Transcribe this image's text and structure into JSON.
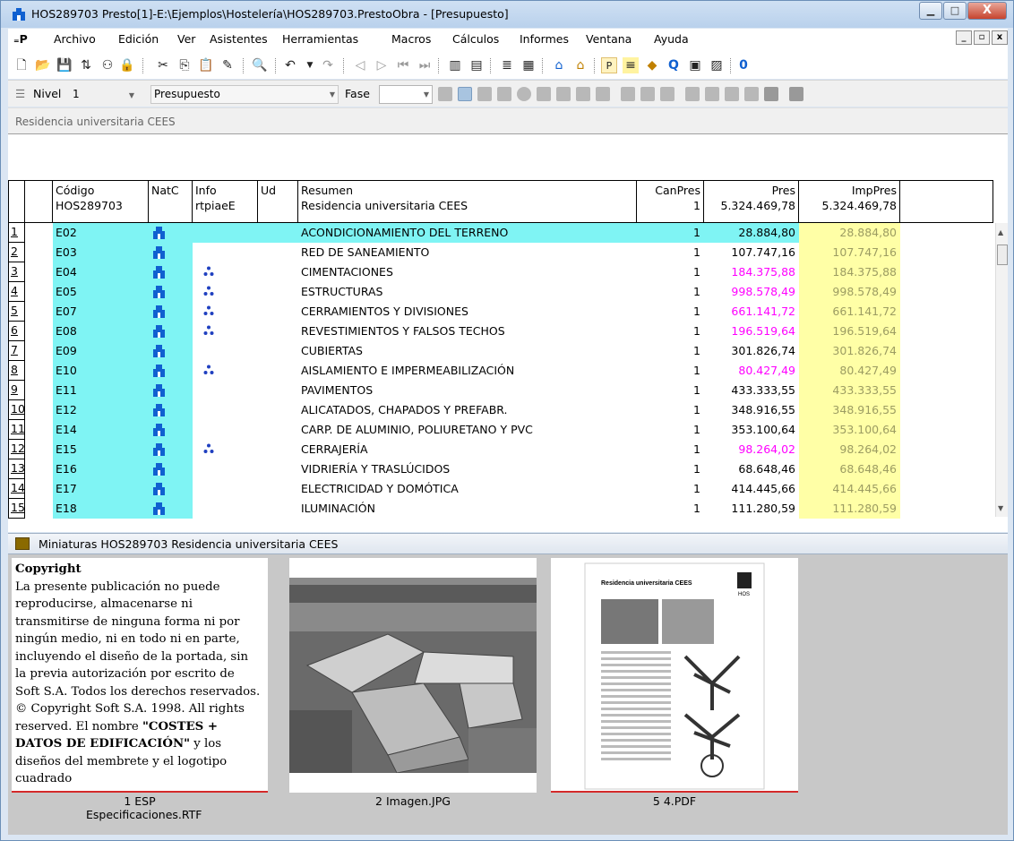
{
  "window": {
    "title": "HOS289703 Presto[1]-E:\\Ejemplos\\Hostelería\\HOS289703.PrestoObra - [Presupuesto]",
    "minimize": "▁",
    "maximize": "□",
    "close": "X"
  },
  "menu": {
    "items": [
      "Archivo",
      "Edición",
      "Ver",
      "Asistentes",
      "Herramientas",
      "Macros",
      "Cálculos",
      "Informes",
      "Ventana",
      "Ayuda"
    ],
    "mdi": [
      "_",
      "▫",
      "x"
    ]
  },
  "toolbar2": {
    "nivel_label": "Nivel",
    "nivel_value": "1",
    "view_value": "Presupuesto",
    "fase_label": "Fase",
    "fase_value": ""
  },
  "breadcrumb": "Residencia universitaria CEES",
  "table": {
    "headers": {
      "codigo": "Código",
      "codigo_sub": "HOS289703",
      "natc": "NatC",
      "info": "Info",
      "info_sub": "rtpiaeE",
      "ud": "Ud",
      "resumen": "Resumen",
      "resumen_sub": "Residencia universitaria CEES",
      "canpres": "CanPres",
      "canpres_sub": "1",
      "pres": "Pres",
      "pres_sub": "5.324.469,78",
      "imppres": "ImpPres",
      "imppres_sub": "5.324.469,78"
    },
    "rows": [
      {
        "n": "1",
        "code": "E02",
        "info": false,
        "resumen": "ACONDICIONAMIENTO DEL TERRENO",
        "can": "1",
        "pres": "28.884,80",
        "imp": "28.884,80",
        "pink": false
      },
      {
        "n": "2",
        "code": "E03",
        "info": false,
        "resumen": "RED DE SANEAMIENTO",
        "can": "1",
        "pres": "107.747,16",
        "imp": "107.747,16",
        "pink": false
      },
      {
        "n": "3",
        "code": "E04",
        "info": true,
        "resumen": "CIMENTACIONES",
        "can": "1",
        "pres": "184.375,88",
        "imp": "184.375,88",
        "pink": true
      },
      {
        "n": "4",
        "code": "E05",
        "info": true,
        "resumen": "ESTRUCTURAS",
        "can": "1",
        "pres": "998.578,49",
        "imp": "998.578,49",
        "pink": true
      },
      {
        "n": "5",
        "code": "E07",
        "info": true,
        "resumen": "CERRAMIENTOS Y DIVISIONES",
        "can": "1",
        "pres": "661.141,72",
        "imp": "661.141,72",
        "pink": true
      },
      {
        "n": "6",
        "code": "E08",
        "info": true,
        "resumen": "REVESTIMIENTOS Y FALSOS TECHOS",
        "can": "1",
        "pres": "196.519,64",
        "imp": "196.519,64",
        "pink": true
      },
      {
        "n": "7",
        "code": "E09",
        "info": false,
        "resumen": "CUBIERTAS",
        "can": "1",
        "pres": "301.826,74",
        "imp": "301.826,74",
        "pink": false
      },
      {
        "n": "8",
        "code": "E10",
        "info": true,
        "resumen": "AISLAMIENTO E IMPERMEABILIZACIÓN",
        "can": "1",
        "pres": "80.427,49",
        "imp": "80.427,49",
        "pink": true
      },
      {
        "n": "9",
        "code": "E11",
        "info": false,
        "resumen": "PAVIMENTOS",
        "can": "1",
        "pres": "433.333,55",
        "imp": "433.333,55",
        "pink": false
      },
      {
        "n": "10",
        "code": "E12",
        "info": false,
        "resumen": "ALICATADOS, CHAPADOS Y PREFABR.",
        "can": "1",
        "pres": "348.916,55",
        "imp": "348.916,55",
        "pink": false
      },
      {
        "n": "11",
        "code": "E14",
        "info": false,
        "resumen": "CARP. DE ALUMINIO, POLIURETANO Y PVC",
        "can": "1",
        "pres": "353.100,64",
        "imp": "353.100,64",
        "pink": false
      },
      {
        "n": "12",
        "code": "E15",
        "info": true,
        "resumen": "CERRAJERÍA",
        "can": "1",
        "pres": "98.264,02",
        "imp": "98.264,02",
        "pink": true
      },
      {
        "n": "13",
        "code": "E16",
        "info": false,
        "resumen": "VIDRIERÍA Y TRASLÚCIDOS",
        "can": "1",
        "pres": "68.648,46",
        "imp": "68.648,46",
        "pink": false
      },
      {
        "n": "14",
        "code": "E17",
        "info": false,
        "resumen": "ELECTRICIDAD Y DOMÓTICA",
        "can": "1",
        "pres": "414.445,66",
        "imp": "414.445,66",
        "pink": false
      },
      {
        "n": "15",
        "code": "E18",
        "info": false,
        "resumen": "ILUMINACIÓN",
        "can": "1",
        "pres": "111.280,59",
        "imp": "111.280,59",
        "pink": false
      }
    ]
  },
  "thumbnails": {
    "pane_title": "Miniaturas HOS289703 Residencia universitaria CEES",
    "rtf_text": {
      "heading": "Copyright",
      "body1": "La presente publicación no puede reproducirse, almacenarse ni transmitirse de ninguna forma ni por ningún medio, ni en todo ni en parte, incluyendo el diseño de la portada, sin la previa autorización por escrito de Soft S.A. Todos los derechos reservados. © Copyright Soft S.A. 1998. All rights reserved. El nombre ",
      "bold": "\"COSTES + DATOS DE EDIFICACIÓN\"",
      "body2": " y los diseños del membrete y el logotipo cuadrado"
    },
    "pdf_page": {
      "title": "Residencia universitaria CEES",
      "logo": "HOS"
    },
    "labels": [
      "1 ESP Especificaciones.RTF",
      "2 Imagen.JPG",
      "5 4.PDF"
    ]
  },
  "colors": {
    "code_bg": "#7ff4f4",
    "imp_bg": "#ffffa6",
    "pink_text": "#ff00ff",
    "selected_row": "#7ff4f4"
  }
}
